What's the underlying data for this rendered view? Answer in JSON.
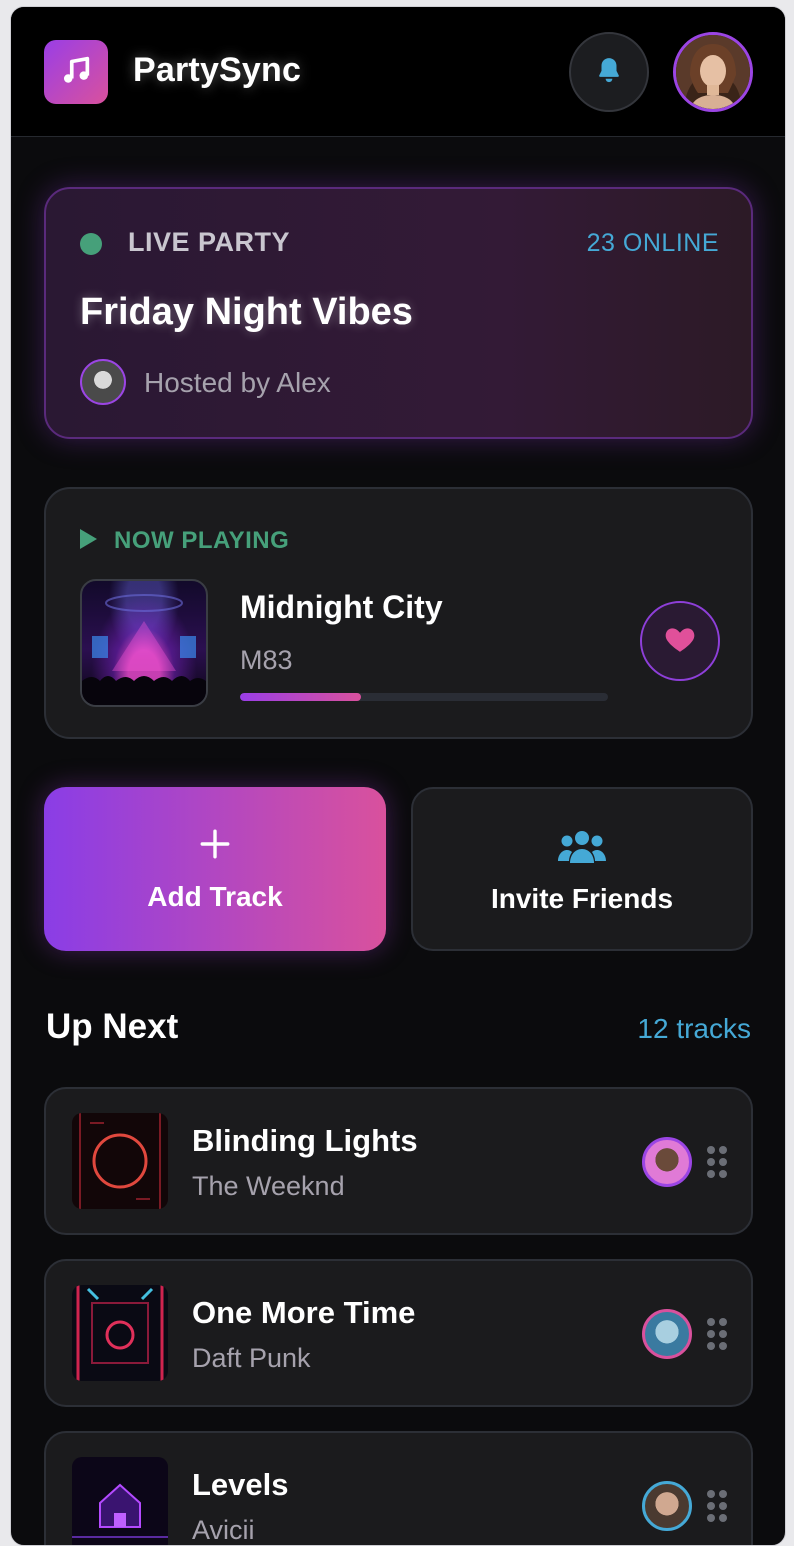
{
  "app": {
    "title": "PartySync",
    "accent_purple": "#9a3ee6",
    "accent_pink": "#d9519d",
    "accent_blue": "#45a9d6",
    "accent_green": "#46a07a"
  },
  "header": {
    "logo_icon": "music-note-icon",
    "notification_icon": "bell-icon",
    "profile_avatar": "user-avatar"
  },
  "live_party": {
    "status_label": "LIVE PARTY",
    "online_count": "23 ONLINE",
    "name": "Friday Night Vibes",
    "host_text": "Hosted by Alex"
  },
  "now_playing": {
    "label": "NOW PLAYING",
    "title": "Midnight City",
    "artist": "M83",
    "progress": 0.33,
    "like_icon": "heart-icon"
  },
  "actions": {
    "add_track_label": "Add Track",
    "add_track_icon": "plus-icon",
    "invite_label": "Invite Friends",
    "invite_icon": "users-icon"
  },
  "up_next": {
    "title": "Up Next",
    "count": "12 tracks",
    "tracks": [
      {
        "title": "Blinding Lights",
        "artist": "The Weeknd",
        "art_color": "#c0243a",
        "user_ring": "#9b45e4"
      },
      {
        "title": "One More Time",
        "artist": "Daft Punk",
        "art_color": "#d0244f",
        "user_ring": "#d9519d"
      },
      {
        "title": "Levels",
        "artist": "Avicii",
        "art_color": "#7a2ad6",
        "user_ring": "#45a9d6"
      }
    ]
  }
}
